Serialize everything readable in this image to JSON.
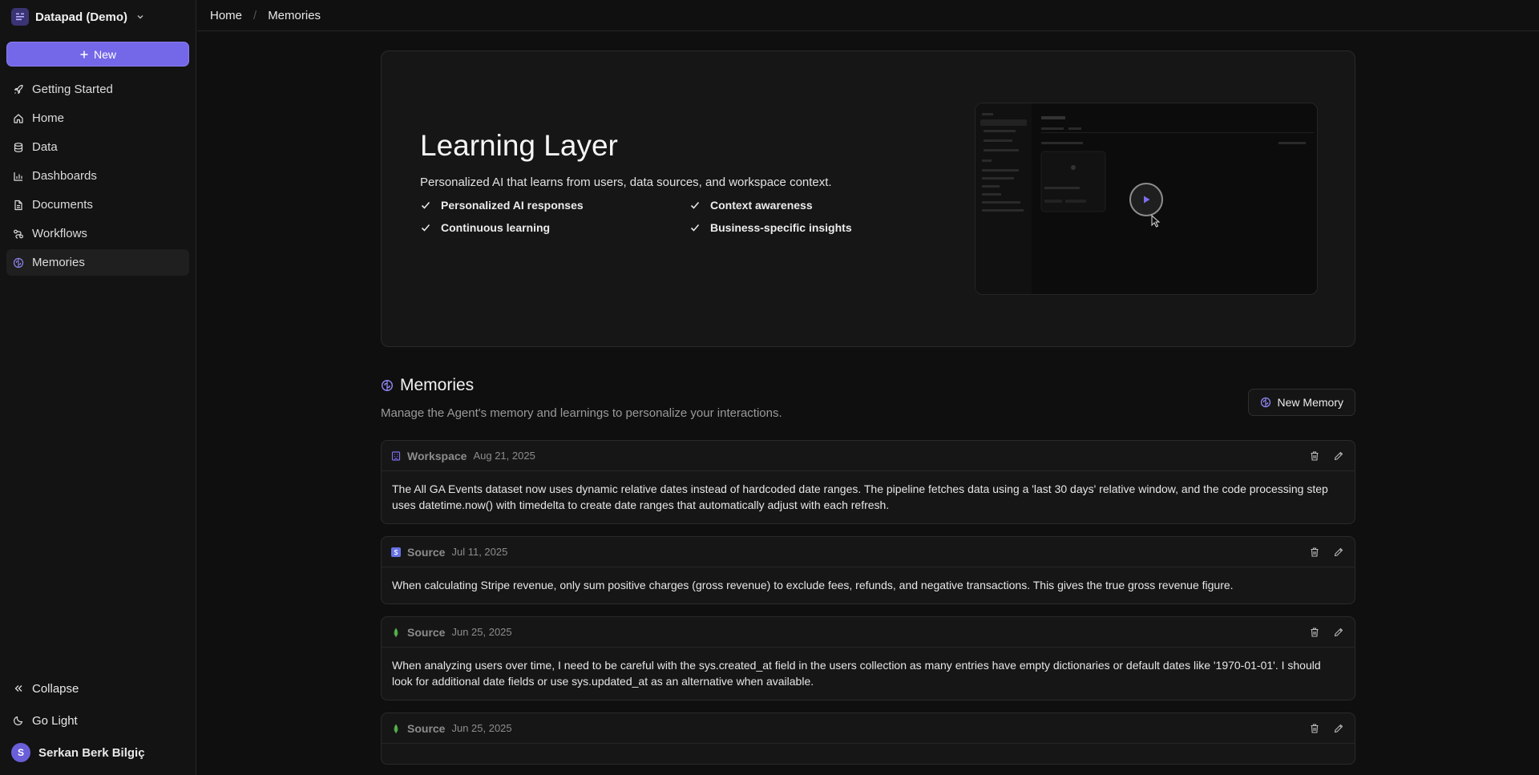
{
  "workspace": {
    "name": "Datapad (Demo)"
  },
  "sidebar": {
    "new_label": "New",
    "items": [
      {
        "label": "Getting Started",
        "icon": "rocket-icon"
      },
      {
        "label": "Home",
        "icon": "home-icon"
      },
      {
        "label": "Data",
        "icon": "database-icon"
      },
      {
        "label": "Dashboards",
        "icon": "bar-chart-icon"
      },
      {
        "label": "Documents",
        "icon": "document-icon"
      },
      {
        "label": "Workflows",
        "icon": "workflow-icon"
      },
      {
        "label": "Memories",
        "icon": "brain-icon",
        "active": true
      }
    ],
    "collapse_label": "Collapse",
    "theme_label": "Go Light",
    "user": {
      "initial": "S",
      "name": "Serkan Berk Bilgiç"
    }
  },
  "breadcrumb": [
    "Home",
    "Memories"
  ],
  "hero": {
    "title": "Learning Layer",
    "subtitle": "Personalized AI that learns from users, data sources, and workspace context.",
    "features": [
      "Personalized AI responses",
      "Context awareness",
      "Continuous learning",
      "Business-specific insights"
    ]
  },
  "memories": {
    "title": "Memories",
    "description": "Manage the Agent's memory and learnings to personalize your interactions.",
    "new_button": "New Memory",
    "items": [
      {
        "type": "Workspace",
        "date": "Aug 21, 2025",
        "icon": "workspace-icon",
        "text": "The All GA Events dataset now uses dynamic relative dates instead of hardcoded date ranges. The pipeline fetches data using a 'last 30 days' relative window, and the code processing step uses datetime.now() with timedelta to create date ranges that automatically adjust with each refresh."
      },
      {
        "type": "Source",
        "date": "Jul 11, 2025",
        "icon": "stripe-icon",
        "text": "When calculating Stripe revenue, only sum positive charges (gross revenue) to exclude fees, refunds, and negative transactions. This gives the true gross revenue figure."
      },
      {
        "type": "Source",
        "date": "Jun 25, 2025",
        "icon": "mongodb-icon",
        "text": "When analyzing users over time, I need to be careful with the sys.created_at field in the users collection as many entries have empty dictionaries or default dates like '1970-01-01'. I should look for additional date fields or use sys.updated_at as an alternative when available."
      },
      {
        "type": "Source",
        "date": "Jun 25, 2025",
        "icon": "mongodb-icon",
        "text": ""
      }
    ]
  },
  "colors": {
    "accent": "#7467e8",
    "background": "#0f0f0f",
    "card": "#161616"
  }
}
